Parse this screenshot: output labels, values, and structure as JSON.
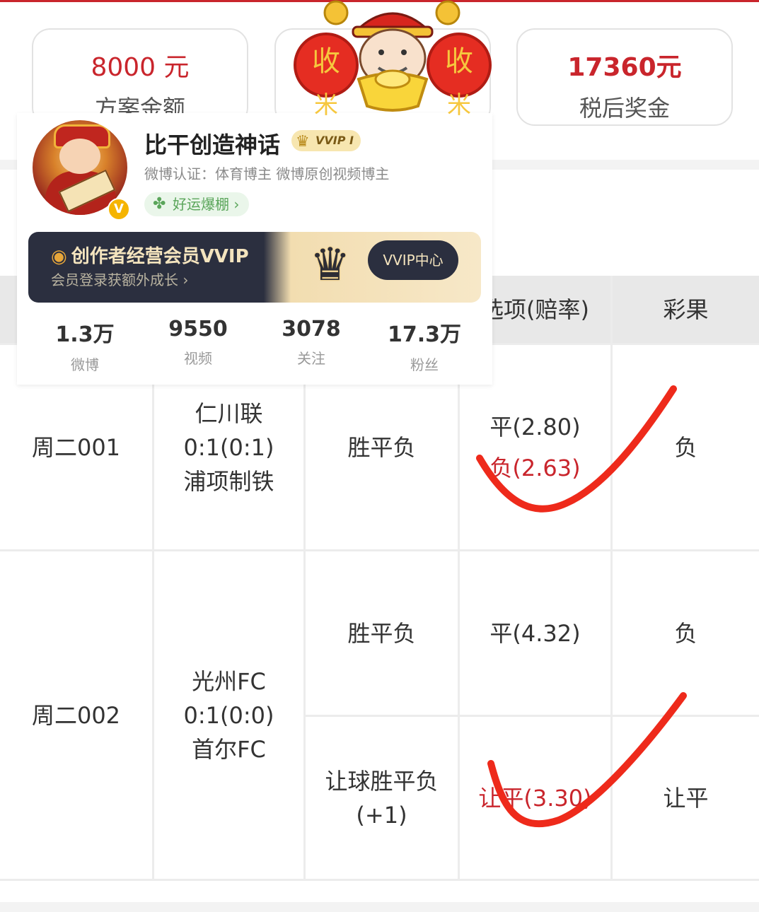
{
  "summary": {
    "plan_amount": "8000 元",
    "plan_amount_label": "方案金额",
    "prize_amount": "17360元",
    "prize_amount_label": "税后奖金"
  },
  "profile": {
    "name": "比干创造神话",
    "vvip_badge": "VVIP I",
    "verify": "微博认证：体育博主 微博原创视频博主",
    "luck": "好运爆棚 ›",
    "banner_title": "创作者经营会员VVIP",
    "banner_sub": "会员登录获额外成长 ›",
    "banner_button": "VVIP中心",
    "stats": [
      {
        "num": "1.3万",
        "label": "微博"
      },
      {
        "num": "9550",
        "label": "视频"
      },
      {
        "num": "3078",
        "label": "关注"
      },
      {
        "num": "17.3万",
        "label": "粉丝"
      }
    ]
  },
  "mascot": {
    "left_text": "收",
    "right_text": "收",
    "left_sub": "米",
    "right_sub": "米"
  },
  "table": {
    "headers": [
      "选项(赔率)",
      "彩果"
    ],
    "rows": [
      {
        "code": "周二001",
        "home": "仁川联",
        "score": "0:1(0:1)",
        "away": "浦项制铁",
        "play": "胜平负",
        "option_1": "平(2.80)",
        "option_2": "负(2.63)",
        "result": "负"
      },
      {
        "code": "周二002",
        "home": "光州FC",
        "score": "0:1(0:0)",
        "away": "首尔FC",
        "play": "胜平负",
        "option": "平(4.32)",
        "result": "负",
        "play_2_line1": "让球胜平负",
        "play_2_line2": "(+1)",
        "option_2": "让平(3.30)",
        "result_2": "让平"
      }
    ]
  },
  "colors": {
    "accent_red": "#c9252c",
    "check_red": "#ee2a1b",
    "header_gray": "#e8e8e8"
  }
}
